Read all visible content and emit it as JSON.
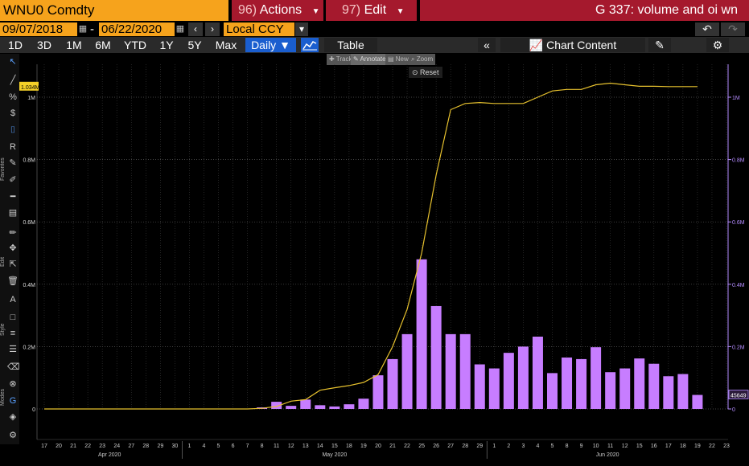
{
  "header": {
    "ticker": "WNU0 Comdty",
    "actions_num": "96)",
    "actions_label": "Actions",
    "edit_num": "97)",
    "edit_label": "Edit",
    "title": "G 337: volume and oi wn"
  },
  "controls": {
    "start_date": "09/07/2018",
    "separator": "-",
    "end_date": "06/22/2020",
    "currency": "Local CCY",
    "ranges": [
      "1D",
      "3D",
      "1M",
      "6M",
      "YTD",
      "1Y",
      "5Y",
      "Max"
    ],
    "frequency": "Daily",
    "table_label": "Table",
    "chart_content_label": "Chart Content"
  },
  "chart_tools": {
    "track": "Track",
    "annotate": "Annotate",
    "news": "News",
    "zoom": "Zoom",
    "reset": "Reset"
  },
  "left_toolbar": {
    "section_labels": [
      "Favorites",
      "Edit",
      "Style",
      "Modes"
    ]
  },
  "colors": {
    "volume_bar": "#c77dff",
    "oi_line": "#e6c12e",
    "oi_label_bg": "#f5d128",
    "right_axis": "#b48cff",
    "accent_orange": "#f6a31c",
    "accent_red": "#a5192d"
  },
  "chart_data": {
    "type": "bar",
    "x": [
      "17",
      "20",
      "21",
      "22",
      "23",
      "24",
      "27",
      "28",
      "29",
      "30",
      "1",
      "4",
      "5",
      "6",
      "7",
      "8",
      "11",
      "12",
      "13",
      "14",
      "15",
      "18",
      "19",
      "20",
      "21",
      "22",
      "25",
      "26",
      "27",
      "28",
      "29",
      "1",
      "2",
      "3",
      "4",
      "5",
      "8",
      "9",
      "10",
      "11",
      "12",
      "15",
      "16",
      "17",
      "18",
      "19",
      "22",
      "23"
    ],
    "months": [
      {
        "label": "Apr 2020",
        "start": "17"
      },
      {
        "label": "May 2020",
        "start": "1"
      },
      {
        "label": "Jun 2020",
        "start": "1"
      }
    ],
    "yticks": [
      0,
      0.2,
      0.4,
      0.6,
      0.8,
      1.0
    ],
    "ytick_labels": [
      "0",
      "0.2M",
      "0.4M",
      "0.6M",
      "0.8M",
      "1M"
    ],
    "ylim": [
      0,
      1.1
    ],
    "grid": true,
    "series": [
      {
        "type": "bar",
        "values": [
          0,
          0,
          0,
          0,
          0,
          0,
          0,
          0,
          0,
          0,
          0,
          0,
          0,
          0,
          0,
          0.005,
          0.023,
          0.01,
          0.03,
          0.012,
          0.008,
          0.015,
          0.033,
          0.108,
          0.16,
          0.24,
          0.48,
          0.33,
          0.24,
          0.24,
          0.143,
          0.13,
          0.18,
          0.2,
          0.232,
          0.115,
          0.165,
          0.16,
          0.198,
          0.118,
          0.13,
          0.162,
          0.145,
          0.105,
          0.112,
          0.045,
          null,
          null
        ],
        "last_label": "45649"
      },
      {
        "type": "line",
        "values": [
          0,
          0,
          0,
          0,
          0,
          0,
          0,
          0,
          0,
          0,
          0,
          0,
          0,
          0,
          0,
          0.002,
          0.008,
          0.025,
          0.03,
          0.06,
          0.068,
          0.075,
          0.085,
          0.11,
          0.2,
          0.32,
          0.5,
          0.75,
          0.96,
          0.98,
          0.983,
          0.98,
          0.98,
          0.98,
          1.0,
          1.02,
          1.025,
          1.025,
          1.04,
          1.045,
          1.04,
          1.035,
          1.035,
          1.034,
          1.034,
          1.034,
          null,
          null
        ],
        "last_label": "1.034M"
      }
    ]
  }
}
